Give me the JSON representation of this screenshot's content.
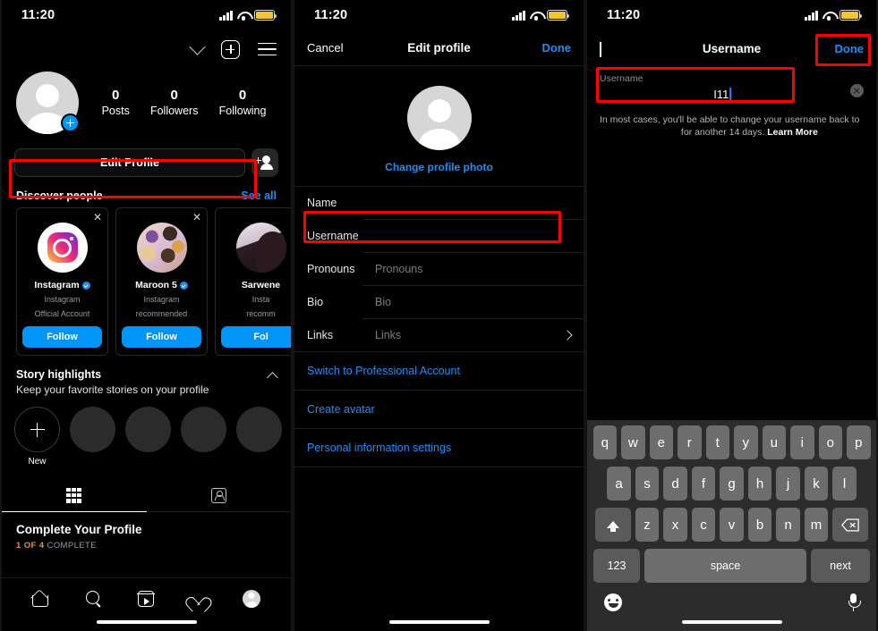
{
  "status_bar": {
    "time": "11:20",
    "icons": [
      "signal-bars",
      "wifi",
      "battery"
    ],
    "battery_color": "#f4c430"
  },
  "colors": {
    "accent_blue": "#0095f6",
    "link_blue": "#1e8ef5",
    "highlight_red": "#ff0000",
    "orange": "#e8933a"
  },
  "panel1": {
    "header": {
      "chevron": "chevron-down",
      "add": "plus-box",
      "menu": "hamburger"
    },
    "stats": [
      {
        "num": "0",
        "label": "Posts"
      },
      {
        "num": "0",
        "label": "Followers"
      },
      {
        "num": "0",
        "label": "Following"
      }
    ],
    "edit_profile_button": "Edit Profile",
    "add_user_button": "add-user",
    "discover": {
      "title": "Discover people",
      "see_all": "See all"
    },
    "discover_cards": [
      {
        "name": "Instagram",
        "verified": true,
        "sub1": "Instagram",
        "sub2": "Official Account",
        "follow": "Follow",
        "avatar": "instagram-logo"
      },
      {
        "name": "Maroon 5",
        "verified": true,
        "sub1": "Instagram",
        "sub2": "recommended",
        "follow": "Follow",
        "avatar": "flowers-photo"
      },
      {
        "name": "Sarwene",
        "verified": false,
        "sub1": "Insta",
        "sub2": "recomm",
        "follow": "Fol",
        "avatar": "portrait-photo"
      }
    ],
    "story_highlights": {
      "title": "Story highlights",
      "desc": "Keep your favorite stories on your profile",
      "new_label": "New"
    },
    "tabs": [
      {
        "icon": "grid-icon",
        "active": true
      },
      {
        "icon": "tagged-icon",
        "active": false
      }
    ],
    "complete_profile": {
      "title": "Complete Your Profile",
      "progress": "1 OF 4",
      "progress_suffix": "COMPLETE"
    },
    "bottom_nav": [
      "home-icon",
      "search-icon",
      "reels-icon",
      "heart-icon",
      "profile-avatar"
    ]
  },
  "panel2": {
    "header": {
      "cancel": "Cancel",
      "title": "Edit profile",
      "done": "Done"
    },
    "change_photo": "Change profile photo",
    "fields": [
      {
        "key": "Name",
        "value": "",
        "placeholder": ""
      },
      {
        "key": "Username",
        "value": "",
        "placeholder": ""
      },
      {
        "key": "Pronouns",
        "value": "",
        "placeholder": "Pronouns"
      },
      {
        "key": "Bio",
        "value": "",
        "placeholder": "Bio"
      },
      {
        "key": "Links",
        "value": "",
        "placeholder": "Links",
        "chevron": true
      }
    ],
    "links": [
      "Switch to Professional Account",
      "Create avatar",
      "Personal information settings"
    ]
  },
  "panel3": {
    "header": {
      "back": "back-chevron",
      "title": "Username",
      "done": "Done"
    },
    "field": {
      "label": "Username",
      "value": "I11",
      "clear": "clear-icon"
    },
    "helper_part1": "In most cases, you'll be able to change your username back to",
    "helper_part2": "for another 14 days.",
    "helper_link": "Learn More",
    "keyboard": {
      "row1": [
        "q",
        "w",
        "e",
        "r",
        "t",
        "y",
        "u",
        "i",
        "o",
        "p"
      ],
      "row2": [
        "a",
        "s",
        "d",
        "f",
        "g",
        "h",
        "j",
        "k",
        "l"
      ],
      "row3": [
        "z",
        "x",
        "c",
        "v",
        "b",
        "n",
        "m"
      ],
      "shift": "shift-icon",
      "backspace": "backspace-icon",
      "numbers": "123",
      "space": "space",
      "return": "next",
      "emoji": "emoji-icon",
      "mic": "microphone-icon"
    }
  }
}
